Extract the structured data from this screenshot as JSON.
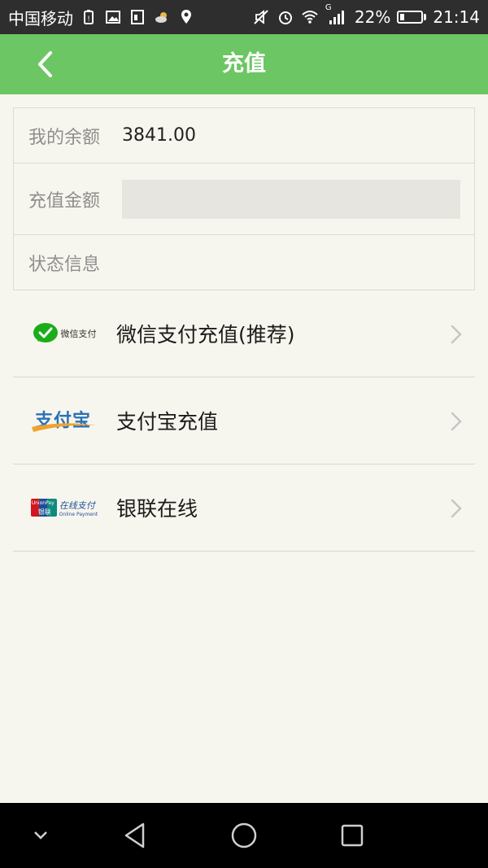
{
  "status_bar": {
    "carrier": "中国移动",
    "signal_tag": "G",
    "battery_percent": "22%",
    "battery_level": 0.22,
    "time": "21:14",
    "icons": [
      "battery-alert-icon",
      "image-icon",
      "sim-icon",
      "weather-icon",
      "location-icon",
      "mute-icon",
      "alarm-icon",
      "wifi-icon",
      "signal-icon",
      "battery-icon"
    ]
  },
  "header": {
    "title": "充值",
    "back_icon": "chevron-left-icon",
    "background": "#6cc664"
  },
  "info": {
    "balance_label": "我的余额",
    "balance_value": "3841.00",
    "amount_label": "充值金额",
    "amount_value": "",
    "status_label": "状态信息",
    "status_value": ""
  },
  "payments": [
    {
      "label": "微信支付充值(推荐)",
      "logo_text": "微信支付",
      "icon": "wechat-pay-logo"
    },
    {
      "label": "支付宝充值",
      "logo_text": "支付宝",
      "icon": "alipay-logo"
    },
    {
      "label": "银联在线",
      "logo_text": "在线支付",
      "logo_subtext": "Online Payment",
      "logo_brand": "UnionPay",
      "logo_brand_cn": "银联",
      "icon": "unionpay-logo"
    }
  ],
  "nav": {
    "icons": [
      "collapse-icon",
      "back-triangle-icon",
      "home-circle-icon",
      "recents-square-icon"
    ]
  }
}
